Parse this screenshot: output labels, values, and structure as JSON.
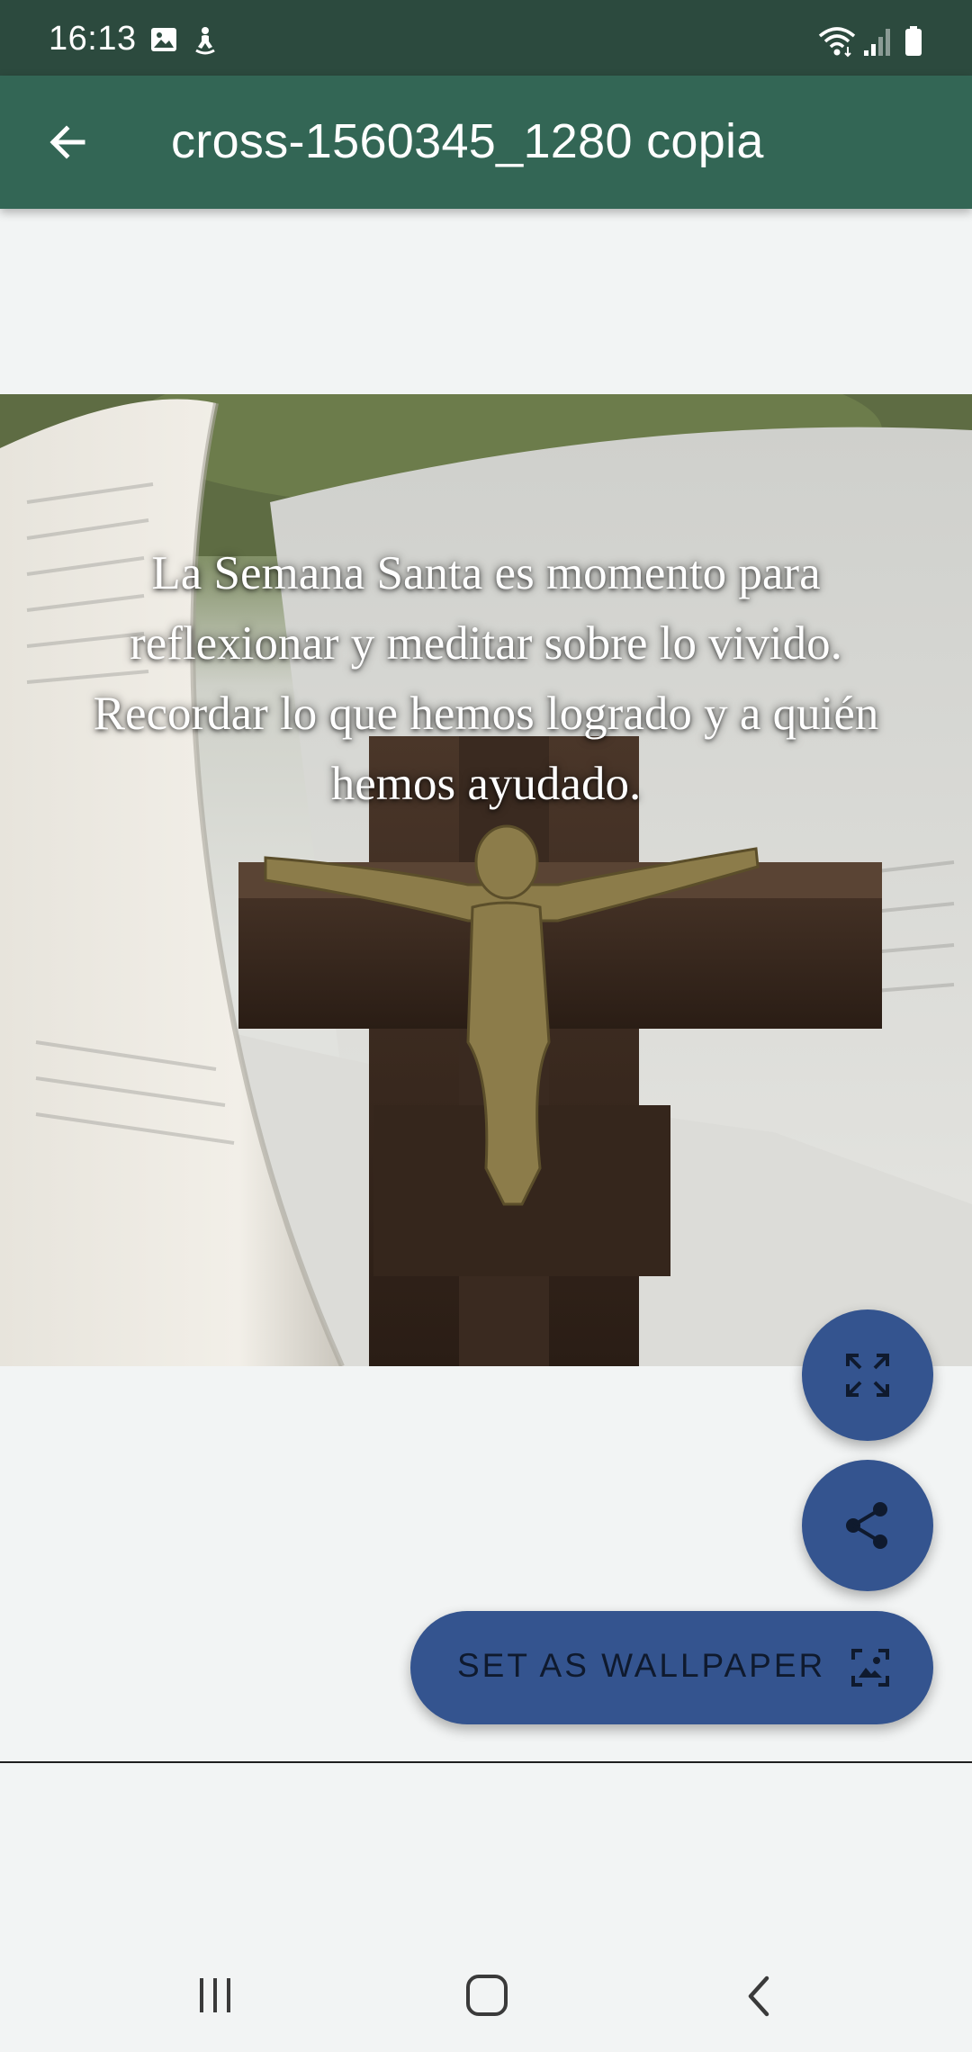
{
  "status_bar": {
    "time": "16:13",
    "left_icons": [
      "image-icon",
      "accessibility-icon"
    ],
    "right_icons": [
      "wifi-icon",
      "signal-icon",
      "battery-icon"
    ]
  },
  "app_bar": {
    "title": "cross-1560345_1280 copia",
    "back_icon": "arrow-back-icon"
  },
  "image": {
    "quote": "La Semana Santa es momento para reflexionar y meditar sobre lo vivido. Recordar lo que hemos logrado y a quién hemos ayudado."
  },
  "actions": {
    "fullscreen_icon": "fullscreen-icon",
    "share_icon": "share-icon",
    "set_wallpaper_label": "SET AS WALLPAPER",
    "set_wallpaper_icon": "wallpaper-icon"
  },
  "nav_bar": {
    "buttons": [
      "recents-icon",
      "home-icon",
      "back-icon"
    ]
  },
  "colors": {
    "status_bar": "#2c4a3e",
    "app_bar": "#336655",
    "fab": "#34548f",
    "background": "#f2f4f4"
  }
}
